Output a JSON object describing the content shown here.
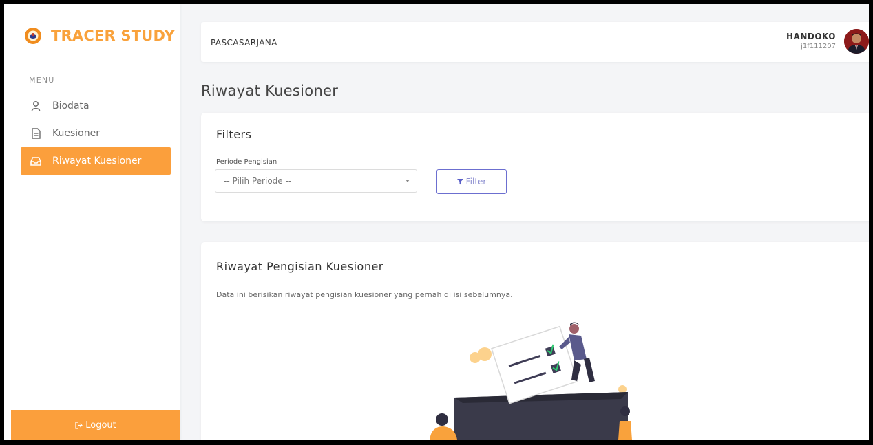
{
  "brand": {
    "title": "TRACER STUDY"
  },
  "sidebar": {
    "menu_label": "MENU",
    "items": [
      {
        "label": "Biodata",
        "icon": "user-icon",
        "active": false
      },
      {
        "label": "Kuesioner",
        "icon": "document-icon",
        "active": false
      },
      {
        "label": "Riwayat Kuesioner",
        "icon": "inbox-icon",
        "active": true
      }
    ],
    "logout_label": "Logout"
  },
  "header": {
    "unit": "PASCASARJANA",
    "user_name": "HANDOKO",
    "user_id": "j1f111207"
  },
  "page": {
    "title": "Riwayat Kuesioner"
  },
  "filters": {
    "title": "Filters",
    "period_label": "Periode Pengisian",
    "period_selected": "-- Pilih Periode --",
    "filter_button": "Filter"
  },
  "history": {
    "title": "Riwayat Pengisian Kuesioner",
    "description": "Data ini berisikan riwayat pengisian kuesioner yang pernah di isi sebelumnya."
  },
  "colors": {
    "accent": "#fb9f3c",
    "button_border": "#6c6fd0"
  }
}
